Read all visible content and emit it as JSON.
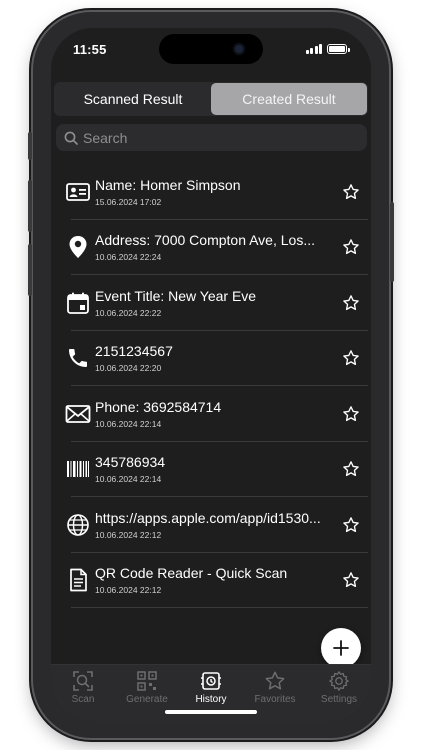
{
  "status_bar": {
    "time": "11:55"
  },
  "segmented": {
    "options": [
      {
        "label": "Scanned Result",
        "active": false
      },
      {
        "label": "Created Result",
        "active": true
      }
    ]
  },
  "search": {
    "placeholder": "Search",
    "value": ""
  },
  "items": [
    {
      "icon": "contact-card-icon",
      "title": "Name: Homer Simpson",
      "date": "15.06.2024 17:02",
      "starred": false
    },
    {
      "icon": "location-pin-icon",
      "title": "Address: 7000 Compton Ave, Los...",
      "date": "10.06.2024 22:24",
      "starred": false
    },
    {
      "icon": "calendar-icon",
      "title": "Event Title: New Year Eve",
      "date": "10.06.2024 22:22",
      "starred": false
    },
    {
      "icon": "phone-icon",
      "title": "2151234567",
      "date": "10.06.2024 22:20",
      "starred": false
    },
    {
      "icon": "envelope-icon",
      "title": "Phone: 3692584714",
      "date": "10.06.2024 22:14",
      "starred": false
    },
    {
      "icon": "barcode-icon",
      "title": "345786934",
      "date": "10.06.2024 22:14",
      "starred": false
    },
    {
      "icon": "globe-icon",
      "title": "https://apps.apple.com/app/id1530...",
      "date": "10.06.2024 22:12",
      "starred": false
    },
    {
      "icon": "document-icon",
      "title": "QR Code Reader - Quick Scan",
      "date": "10.06.2024 22:12",
      "starred": false
    }
  ],
  "fab": {
    "icon": "plus-icon"
  },
  "tabbar": {
    "tabs": [
      {
        "label": "Scan",
        "icon": "scan-icon",
        "active": false
      },
      {
        "label": "Generate",
        "icon": "qr-generate-icon",
        "active": false
      },
      {
        "label": "History",
        "icon": "history-icon",
        "active": true
      },
      {
        "label": "Favorites",
        "icon": "star-icon",
        "active": false
      },
      {
        "label": "Settings",
        "icon": "gear-icon",
        "active": false
      }
    ]
  },
  "colors": {
    "background": "#1e1e1e",
    "active_segment": "#a6a6a8",
    "tab_active": "#ffffff",
    "tab_inactive": "#6e6e72"
  }
}
